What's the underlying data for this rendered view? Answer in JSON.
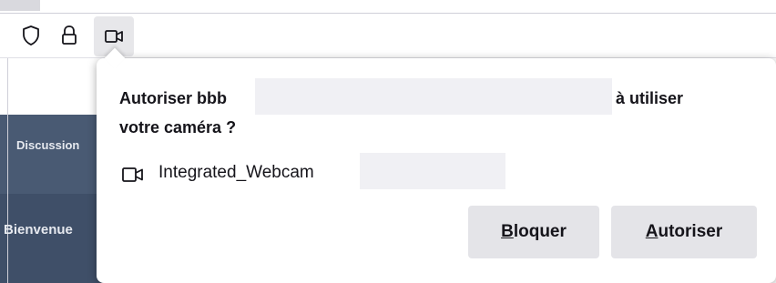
{
  "toolbar": {
    "icons": [
      "shield-icon",
      "lock-icon",
      "camera-icon"
    ]
  },
  "page_behind": {
    "discussion_label": "Discussion",
    "welcome_label": "Bienvenue"
  },
  "permission_prompt": {
    "title_prefix": "Autoriser bbb",
    "title_suffix": "à utiliser",
    "title_line2": "votre caméra ?",
    "device_name": "Integrated_Webcam",
    "block_button": {
      "accel": "B",
      "rest": "loquer"
    },
    "allow_button": {
      "accel": "A",
      "rest": "utoriser"
    }
  },
  "colors": {
    "page_dark": "#3f4f68",
    "button_bg": "#e4e4e8",
    "redaction": "#f0f0f4",
    "text": "#15141a"
  }
}
